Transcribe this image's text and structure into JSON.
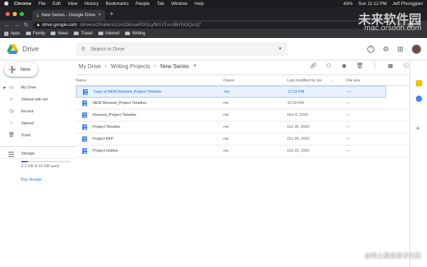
{
  "menubar": {
    "app": "Chrome",
    "items": [
      "File",
      "Edit",
      "View",
      "History",
      "Bookmarks",
      "People",
      "Tab",
      "Window",
      "Help"
    ],
    "battery": "43%",
    "clock": "Sun 11:12 PM",
    "user": "Jeff Phungglan"
  },
  "browser": {
    "tab_title": "New Series - Google Drive",
    "url_host": "drive.google.com",
    "url_path": "/drive/u/2/folders/1JAzDKcsePOI1LyfMYJTvoJBHTsOQvUj7",
    "bookmarks": [
      "Apps",
      "Family",
      "News",
      "Travel",
      "Internet",
      "Writing"
    ]
  },
  "drive": {
    "logo": "Drive",
    "search_placeholder": "Search in Drive",
    "new_label": "New",
    "nav": [
      {
        "label": "My Drive"
      },
      {
        "label": "Shared with me"
      },
      {
        "label": "Recent"
      },
      {
        "label": "Starred"
      },
      {
        "label": "Trash"
      }
    ],
    "storage": {
      "label": "Storage",
      "used_text": "2.2 GB of 15 GB used",
      "fraction": 0.147,
      "buy_label": "Buy storage"
    },
    "breadcrumb": {
      "root": "My Drive",
      "parent": "Writing Projects",
      "current": "New Series"
    },
    "columns": {
      "name": "Name",
      "owner": "Owner",
      "modified": "Last modified by me",
      "size": "File size"
    },
    "files": [
      {
        "name": "Copy of NEW Revised_Project Timeline",
        "owner": "me",
        "modified": "11:12 PM",
        "size": "—"
      },
      {
        "name": "NEW Revised_Project Timeline",
        "owner": "me",
        "modified": "10:34 PM",
        "size": "—"
      },
      {
        "name": "Revised_Project Timeline",
        "owner": "me",
        "modified": "Nov 6, 2020",
        "size": "—"
      },
      {
        "name": "Project Timeline",
        "owner": "me",
        "modified": "Oct 30, 2020",
        "size": "—"
      },
      {
        "name": "Project RFP",
        "owner": "me",
        "modified": "Oct 28, 2020",
        "size": "—"
      },
      {
        "name": "Project Outline",
        "owner": "me",
        "modified": "Oct 22, 2020",
        "size": "—"
      }
    ]
  },
  "watermarks": {
    "brand": "未来软件园",
    "site": "mac.orsoon.com",
    "bottom": "@稀土掘金技术社区"
  },
  "colors": {
    "accent": "#1a73e8",
    "selected_bg": "#e8f0fe",
    "doc_icon": "#4285f4"
  }
}
